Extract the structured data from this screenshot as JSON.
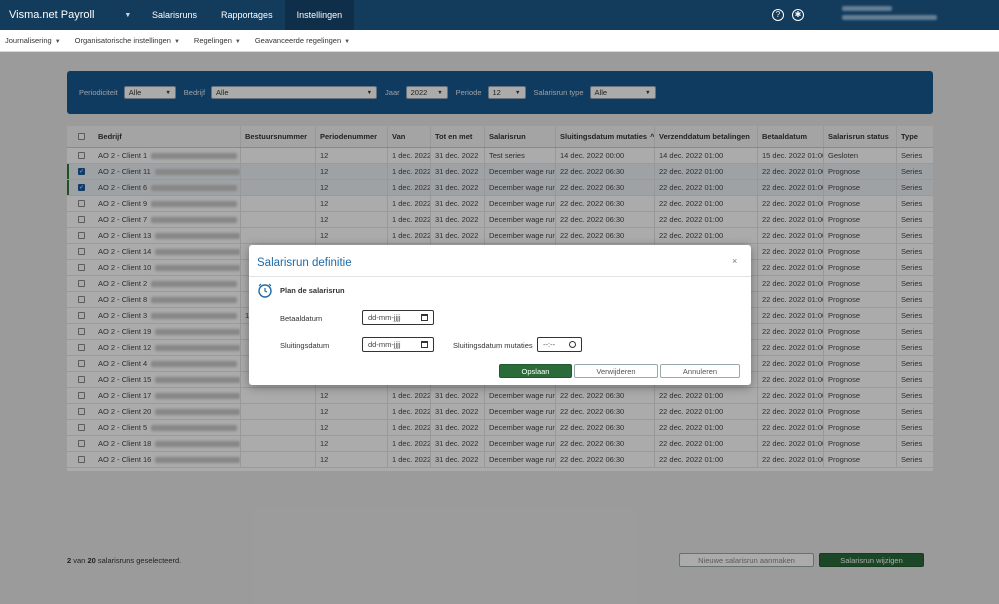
{
  "topbar": {
    "brand": "Visma.net Payroll",
    "nav": [
      "Salarisruns",
      "Rapportages",
      "Instellingen"
    ],
    "active_nav": "Instellingen",
    "help_icon": "help-circle-icon",
    "accessibility_icon": "accessibility-icon"
  },
  "subnav": [
    "Journalisering",
    "Organisatorische instellingen",
    "Regelingen",
    "Geavanceerde regelingen"
  ],
  "filter": {
    "periodiciteit_label": "Periodiciteit",
    "periodiciteit_value": "Alle",
    "bedrijf_label": "Bedrijf",
    "bedrijf_value": "Alle",
    "jaar_label": "Jaar",
    "jaar_value": "2022",
    "periode_label": "Periode",
    "periode_value": "12",
    "type_label": "Salarisrun type",
    "type_value": "Alle"
  },
  "table": {
    "headers": [
      "Bedrijf",
      "Bestuursnummer",
      "Periodenummer",
      "Van",
      "Tot en met",
      "Salarisrun",
      "Sluitingsdatum mutaties",
      "Verzenddatum betalingen",
      "Betaaldatum",
      "Salarisrun status",
      "Type"
    ],
    "sort_indicator": "^",
    "rows": [
      {
        "bedrijf": "AO 2 - Client 1",
        "bestuur": "",
        "periode": "12",
        "van": "1 dec. 2022",
        "tot": "31 dec. 2022",
        "salarisrun": "Test series",
        "sluiting": "14 dec. 2022 00:00",
        "verzend": "14 dec. 2022 01:00",
        "betaal": "15 dec. 2022 01:00",
        "status": "Gesloten",
        "type": "Series",
        "checked": false
      },
      {
        "bedrijf": "AO 2 - Client 11",
        "bestuur": "",
        "periode": "12",
        "van": "1 dec. 2022",
        "tot": "31 dec. 2022",
        "salarisrun": "December wage run",
        "sluiting": "22 dec. 2022 06:30",
        "verzend": "22 dec. 2022 01:00",
        "betaal": "22 dec. 2022 01:00",
        "status": "Prognose",
        "type": "Series",
        "checked": true
      },
      {
        "bedrijf": "AO 2 - Client 6",
        "bestuur": "",
        "periode": "12",
        "van": "1 dec. 2022",
        "tot": "31 dec. 2022",
        "salarisrun": "December wage run",
        "sluiting": "22 dec. 2022 06:30",
        "verzend": "22 dec. 2022 01:00",
        "betaal": "22 dec. 2022 01:00",
        "status": "Prognose",
        "type": "Series",
        "checked": true
      },
      {
        "bedrijf": "AO 2 - Client 9",
        "bestuur": "",
        "periode": "12",
        "van": "1 dec. 2022",
        "tot": "31 dec. 2022",
        "salarisrun": "December wage run",
        "sluiting": "22 dec. 2022 06:30",
        "verzend": "22 dec. 2022 01:00",
        "betaal": "22 dec. 2022 01:00",
        "status": "Prognose",
        "type": "Series",
        "checked": false
      },
      {
        "bedrijf": "AO 2 - Client 7",
        "bestuur": "",
        "periode": "12",
        "van": "1 dec. 2022",
        "tot": "31 dec. 2022",
        "salarisrun": "December wage run",
        "sluiting": "22 dec. 2022 06:30",
        "verzend": "22 dec. 2022 01:00",
        "betaal": "22 dec. 2022 01:00",
        "status": "Prognose",
        "type": "Series",
        "checked": false
      },
      {
        "bedrijf": "AO 2 - Client 13",
        "bestuur": "",
        "periode": "12",
        "van": "1 dec. 2022",
        "tot": "31 dec. 2022",
        "salarisrun": "December wage run",
        "sluiting": "22 dec. 2022 06:30",
        "verzend": "22 dec. 2022 01:00",
        "betaal": "22 dec. 2022 01:00",
        "status": "Prognose",
        "type": "Series",
        "checked": false
      },
      {
        "bedrijf": "AO 2 - Client 14",
        "bestuur": "",
        "periode": "",
        "van": "",
        "tot": "",
        "salarisrun": "",
        "sluiting": "",
        "verzend": "",
        "betaal": "22 dec. 2022 01:00",
        "status": "Prognose",
        "type": "Series",
        "checked": false
      },
      {
        "bedrijf": "AO 2 - Client 10",
        "bestuur": "",
        "periode": "",
        "van": "",
        "tot": "",
        "salarisrun": "",
        "sluiting": "",
        "verzend": "",
        "betaal": "22 dec. 2022 01:00",
        "status": "Prognose",
        "type": "Series",
        "checked": false
      },
      {
        "bedrijf": "AO 2 - Client 2",
        "bestuur": "",
        "periode": "",
        "van": "",
        "tot": "",
        "salarisrun": "",
        "sluiting": "",
        "verzend": "",
        "betaal": "22 dec. 2022 01:00",
        "status": "Prognose",
        "type": "Series",
        "checked": false
      },
      {
        "bedrijf": "AO 2 - Client 8",
        "bestuur": "",
        "periode": "",
        "van": "",
        "tot": "",
        "salarisrun": "",
        "sluiting": "",
        "verzend": "",
        "betaal": "22 dec. 2022 01:00",
        "status": "Prognose",
        "type": "Series",
        "checked": false
      },
      {
        "bedrijf": "AO 2 - Client 3",
        "bestuur": "1",
        "periode": "",
        "van": "",
        "tot": "",
        "salarisrun": "",
        "sluiting": "",
        "verzend": "",
        "betaal": "22 dec. 2022 01:00",
        "status": "Prognose",
        "type": "Series",
        "checked": false
      },
      {
        "bedrijf": "AO 2 - Client 19",
        "bestuur": "",
        "periode": "",
        "van": "",
        "tot": "",
        "salarisrun": "",
        "sluiting": "",
        "verzend": "",
        "betaal": "22 dec. 2022 01:00",
        "status": "Prognose",
        "type": "Series",
        "checked": false
      },
      {
        "bedrijf": "AO 2 - Client 12",
        "bestuur": "",
        "periode": "",
        "van": "",
        "tot": "",
        "salarisrun": "",
        "sluiting": "",
        "verzend": "",
        "betaal": "22 dec. 2022 01:00",
        "status": "Prognose",
        "type": "Series",
        "checked": false
      },
      {
        "bedrijf": "AO 2 - Client 4",
        "bestuur": "",
        "periode": "",
        "van": "",
        "tot": "",
        "salarisrun": "",
        "sluiting": "",
        "verzend": "",
        "betaal": "22 dec. 2022 01:00",
        "status": "Prognose",
        "type": "Series",
        "checked": false
      },
      {
        "bedrijf": "AO 2 - Client 15",
        "bestuur": "",
        "periode": "",
        "van": "",
        "tot": "",
        "salarisrun": "",
        "sluiting": "",
        "verzend": "",
        "betaal": "22 dec. 2022 01:00",
        "status": "Prognose",
        "type": "Series",
        "checked": false
      },
      {
        "bedrijf": "AO 2 - Client 17",
        "bestuur": "",
        "periode": "12",
        "van": "1 dec. 2022",
        "tot": "31 dec. 2022",
        "salarisrun": "December wage run",
        "sluiting": "22 dec. 2022 06:30",
        "verzend": "22 dec. 2022 01:00",
        "betaal": "22 dec. 2022 01:00",
        "status": "Prognose",
        "type": "Series",
        "checked": false
      },
      {
        "bedrijf": "AO 2 - Client 20",
        "bestuur": "",
        "periode": "12",
        "van": "1 dec. 2022",
        "tot": "31 dec. 2022",
        "salarisrun": "December wage run",
        "sluiting": "22 dec. 2022 06:30",
        "verzend": "22 dec. 2022 01:00",
        "betaal": "22 dec. 2022 01:00",
        "status": "Prognose",
        "type": "Series",
        "checked": false
      },
      {
        "bedrijf": "AO 2 - Client 5",
        "bestuur": "",
        "periode": "12",
        "van": "1 dec. 2022",
        "tot": "31 dec. 2022",
        "salarisrun": "December wage run",
        "sluiting": "22 dec. 2022 06:30",
        "verzend": "22 dec. 2022 01:00",
        "betaal": "22 dec. 2022 01:00",
        "status": "Prognose",
        "type": "Series",
        "checked": false
      },
      {
        "bedrijf": "AO 2 - Client 18",
        "bestuur": "",
        "periode": "12",
        "van": "1 dec. 2022",
        "tot": "31 dec. 2022",
        "salarisrun": "December wage run",
        "sluiting": "22 dec. 2022 06:30",
        "verzend": "22 dec. 2022 01:00",
        "betaal": "22 dec. 2022 01:00",
        "status": "Prognose",
        "type": "Series",
        "checked": false
      },
      {
        "bedrijf": "AO 2 - Client 16",
        "bestuur": "",
        "periode": "12",
        "van": "1 dec. 2022",
        "tot": "31 dec. 2022",
        "salarisrun": "December wage run",
        "sluiting": "22 dec. 2022 06:30",
        "verzend": "22 dec. 2022 01:00",
        "betaal": "22 dec. 2022 01:00",
        "status": "Prognose",
        "type": "Series",
        "checked": false
      }
    ]
  },
  "footer": {
    "selected_count": "2",
    "van": "van",
    "total_count": "20",
    "suffix": "salarisruns geselecteerd.",
    "new_button": "Nieuwe salarisrun aanmaken",
    "edit_button": "Salarisrun wijzigen"
  },
  "modal": {
    "title": "Salarisrun definitie",
    "close": "×",
    "subtitle": "Plan de salarisrun",
    "betaaldatum_label": "Betaaldatum",
    "betaaldatum_placeholder": "dd-mm-jjjj",
    "sluitingsdatum_label": "Sluitingsdatum",
    "sluitingsdatum_placeholder": "dd-mm-jjjj",
    "mutaties_label": "Sluitingsdatum mutaties",
    "mutaties_placeholder": "--:--",
    "save_button": "Opslaan",
    "delete_button": "Verwijderen",
    "cancel_button": "Annuleren"
  },
  "colors": {
    "topbar": "#133b5c",
    "filter_panel": "#17598f",
    "primary_button": "#2b6b3a",
    "modal_title": "#1f6aa5"
  }
}
